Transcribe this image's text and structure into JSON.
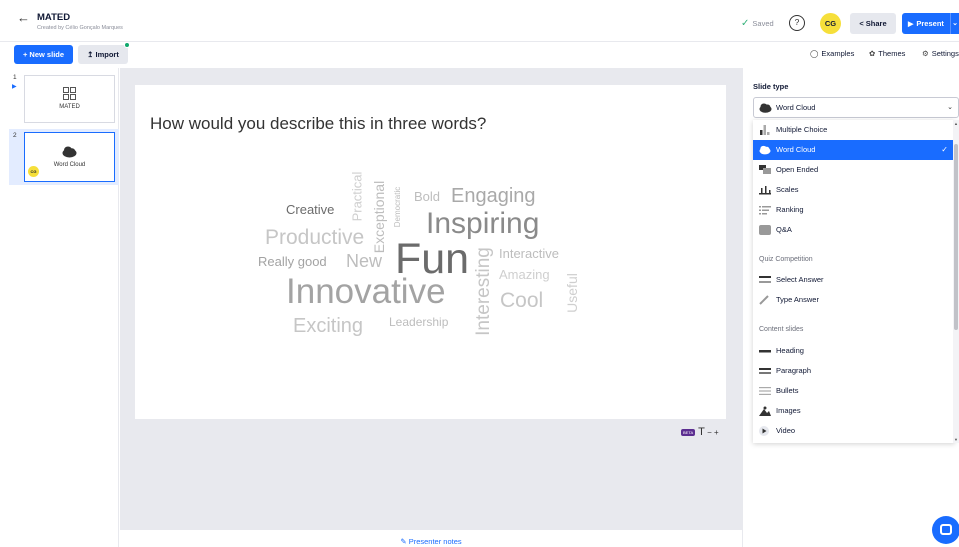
{
  "header": {
    "title": "MATED",
    "author": "Created by Célio Gonçalo Marques",
    "saved": "Saved",
    "avatar": "CG",
    "share": "Share",
    "present": "Present"
  },
  "toolbar": {
    "new_slide": "+ New slide",
    "import": "Import",
    "examples": "Examples",
    "themes": "Themes",
    "settings": "Settings"
  },
  "slides": [
    {
      "number": "1",
      "label": "MATED"
    },
    {
      "number": "2",
      "label": "Word Cloud",
      "avatar": "CG"
    }
  ],
  "slide": {
    "question": "How would you describe this in three words?",
    "words": [
      {
        "text": "Creative",
        "color": "#6b6b6b"
      },
      {
        "text": "Practical",
        "color": "#cfcfcf"
      },
      {
        "text": "Exceptional",
        "color": "#bdbdbd"
      },
      {
        "text": "Democratic",
        "color": "#bdbdbd"
      },
      {
        "text": "Bold",
        "color": "#bdbdbd"
      },
      {
        "text": "Engaging",
        "color": "#a9a9a9"
      },
      {
        "text": "Productive",
        "color": "#c6c6c6"
      },
      {
        "text": "Inspiring",
        "color": "#8a8a8a"
      },
      {
        "text": "Really good",
        "color": "#a3a3a3"
      },
      {
        "text": "New",
        "color": "#bdbdbd"
      },
      {
        "text": "Fun",
        "color": "#6b6b6b"
      },
      {
        "text": "Interesting",
        "color": "#c6c6c6"
      },
      {
        "text": "Interactive",
        "color": "#bdbdbd"
      },
      {
        "text": "Amazing",
        "color": "#cfcfcf"
      },
      {
        "text": "Useful",
        "color": "#cfcfcf"
      },
      {
        "text": "Innovative",
        "color": "#a3a3a3"
      },
      {
        "text": "Cool",
        "color": "#c6c6c6"
      },
      {
        "text": "Exciting",
        "color": "#c6c6c6"
      },
      {
        "text": "Leadership",
        "color": "#bdbdbd"
      }
    ]
  },
  "text_size_control": {
    "badge": "BETA",
    "icon": "T",
    "minus": "−",
    "plus": "+"
  },
  "presenter_notes": "Presenter notes",
  "panel": {
    "slide_type_label": "Slide type",
    "selected_type": "Word Cloud",
    "options": [
      {
        "label": "Multiple Choice",
        "icon": "bar-chart-icon"
      },
      {
        "label": "Word Cloud",
        "icon": "word-cloud-icon",
        "selected": true
      },
      {
        "label": "Open Ended",
        "icon": "speech-bubbles-icon"
      },
      {
        "label": "Scales",
        "icon": "scales-icon"
      },
      {
        "label": "Ranking",
        "icon": "ranking-icon"
      },
      {
        "label": "Q&A",
        "icon": "qa-icon"
      }
    ],
    "quiz_section": "Quiz Competition",
    "quiz_options": [
      {
        "label": "Select Answer",
        "icon": "select-answer-icon"
      },
      {
        "label": "Type Answer",
        "icon": "type-answer-icon"
      }
    ],
    "content_section": "Content slides",
    "content_options": [
      {
        "label": "Heading",
        "icon": "heading-icon"
      },
      {
        "label": "Paragraph",
        "icon": "paragraph-icon"
      },
      {
        "label": "Bullets",
        "icon": "bullets-icon"
      },
      {
        "label": "Images",
        "icon": "images-icon"
      },
      {
        "label": "Video",
        "icon": "video-icon"
      }
    ]
  },
  "colors": {
    "accent": "#196cff",
    "avatar": "#f6df3a",
    "canvas_bg": "#e8e9ee"
  }
}
